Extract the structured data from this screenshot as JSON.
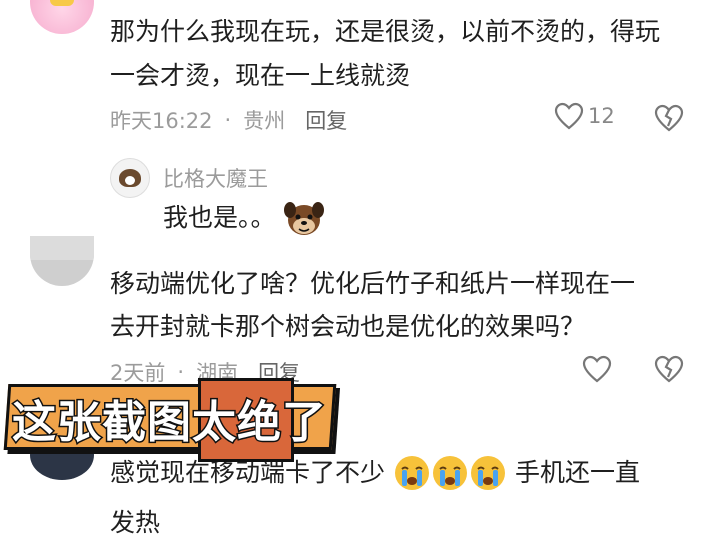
{
  "comment1": {
    "text_line1": "那为什么我现在玩，还是很烫，以前不烫的，得玩",
    "text_line2": "一会才烫，现在一上线就烫",
    "time": "昨天16:22",
    "location": "贵州",
    "reply_label": "回复",
    "likes": "12"
  },
  "reply1": {
    "username": "比格大魔王",
    "text": "我也是。。"
  },
  "comment2": {
    "text_line1": "移动端优化了啥？优化后竹子和纸片一样现在一",
    "text_line2": "去开封就卡那个树会动也是优化的效果吗？",
    "time": "2天前",
    "location": "湖南",
    "reply_label": "回复"
  },
  "comment3": {
    "text_line1_a": "感觉现在移动端卡了不少",
    "text_line1_b": "手机还一直",
    "text_line2": "发热"
  },
  "banner": {
    "text": "这张截图太绝了"
  },
  "icons": {
    "like": "heart-outline-icon",
    "dislike": "broken-heart-icon",
    "crying": "crying-face-emoji",
    "dog_sticker": "dog-sticker"
  }
}
